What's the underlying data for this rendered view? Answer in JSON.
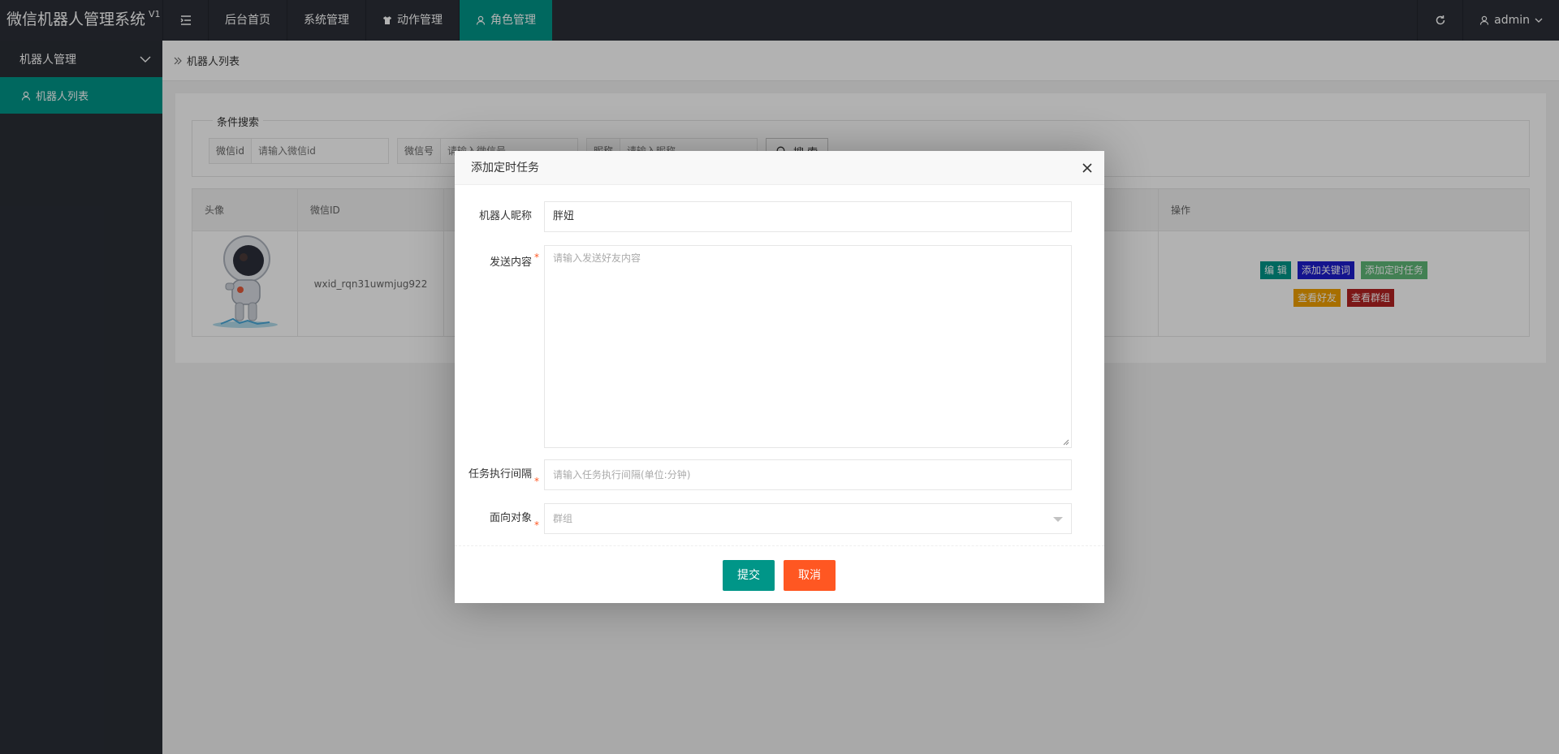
{
  "app": {
    "title": "微信机器人管理系统",
    "version": "V1"
  },
  "topnav": {
    "items": [
      {
        "label": "后台首页"
      },
      {
        "label": "系统管理"
      },
      {
        "label": "动作管理"
      },
      {
        "label": "角色管理"
      }
    ]
  },
  "topright": {
    "user": "admin"
  },
  "sidebar": {
    "group": "机器人管理",
    "items": [
      {
        "label": "机器人列表"
      }
    ]
  },
  "breadcrumb": {
    "current": "机器人列表"
  },
  "search": {
    "legend": "条件搜索",
    "fields": [
      {
        "label": "微信id",
        "placeholder": "请输入微信id"
      },
      {
        "label": "微信号",
        "placeholder": "请输入微信号"
      },
      {
        "label": "昵称",
        "placeholder": "请输入昵称"
      }
    ],
    "button": "搜 索"
  },
  "table": {
    "headers": [
      "头像",
      "微信ID",
      "操作"
    ],
    "rows": [
      {
        "wxid": "wxid_rqn31uwmjug922"
      }
    ],
    "actions": [
      {
        "label": "编 辑",
        "color": "#009688"
      },
      {
        "label": "添加关键词",
        "color": "#1e1ecc"
      },
      {
        "label": "添加定时任务",
        "color": "#5fb878"
      },
      {
        "label": "查看好友",
        "color": "#f0a000"
      },
      {
        "label": "查看群组",
        "color": "#b22222"
      }
    ]
  },
  "dialog": {
    "title": "添加定时任务",
    "fields": {
      "nickname": {
        "label": "机器人昵称",
        "value": "胖妞"
      },
      "content": {
        "label": "发送内容",
        "placeholder": "请输入发送好友内容"
      },
      "interval": {
        "label": "任务执行间隔",
        "placeholder": "请输入任务执行间隔(单位:分钟)"
      },
      "target": {
        "label": "面向对象",
        "value": "群组"
      }
    },
    "submit": "提交",
    "cancel": "取消",
    "colors": {
      "submit": "#009688",
      "cancel": "#ff5722"
    }
  }
}
